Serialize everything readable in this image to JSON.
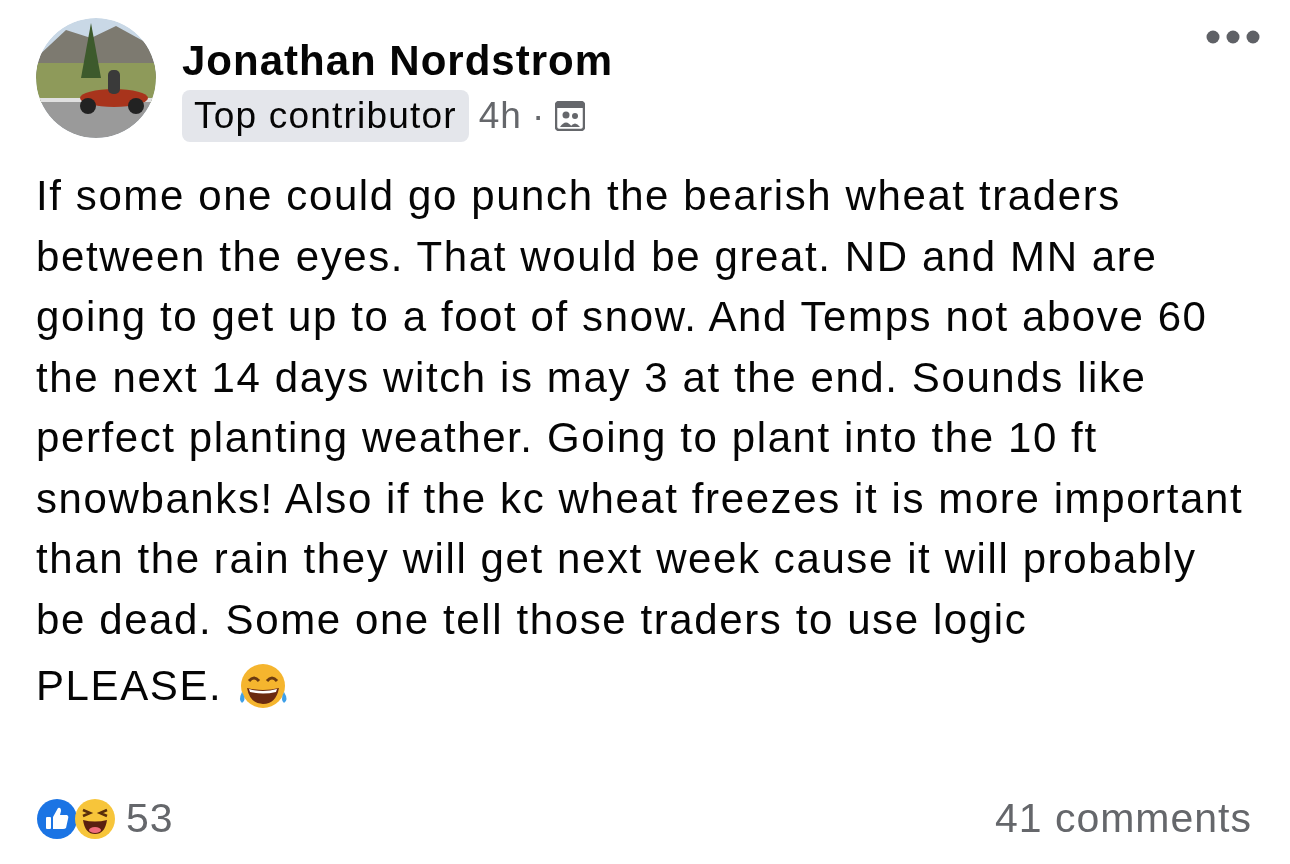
{
  "post": {
    "author": "Jonathan Nordstrom",
    "badge": "Top contributor",
    "time": "4h",
    "separator": "·",
    "body": [
      "If some one could go punch the bearish wheat traders between the eyes. That would be great. ND and MN are going to get up to a foot of snow. And Temps not above 60 the next 14 days witch is may 3 at the end. Sounds like perfect planting weather. Going to plant into the 10 ft snowbanks! Also if the kc wheat freezes it is more important than the rain they will get next week cause it will probably be dead. Some one tell those traders to use logic",
      "PLEASE."
    ],
    "reaction_count": "53",
    "comments": "41 comments"
  }
}
